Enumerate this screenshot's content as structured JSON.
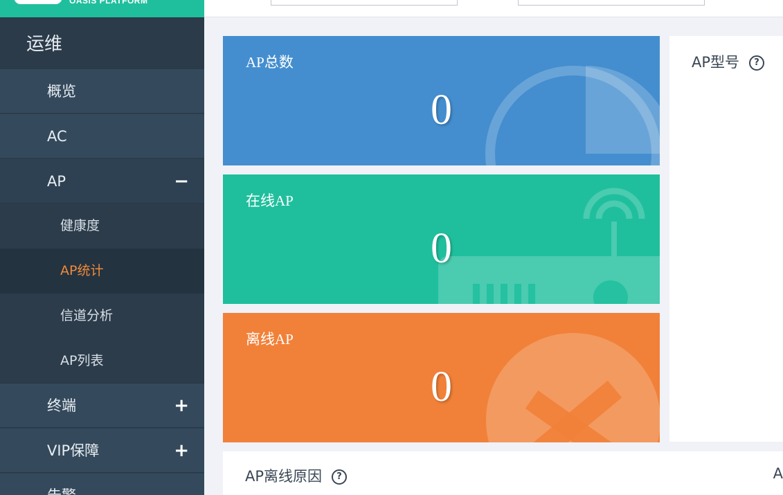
{
  "logo": {
    "subtitle": "OASIS PLATFORM"
  },
  "sidebar": {
    "section": "运维",
    "items": [
      {
        "label": "概览"
      },
      {
        "label": "AC"
      },
      {
        "label": "AP",
        "toggle": "−"
      },
      {
        "label": "健康度"
      },
      {
        "label": "AP统计",
        "active": true
      },
      {
        "label": "信道分析"
      },
      {
        "label": "AP列表"
      },
      {
        "label": "终端",
        "toggle": "+"
      },
      {
        "label": "VIP保障",
        "toggle": "+"
      },
      {
        "label": "告警"
      }
    ]
  },
  "cards": [
    {
      "title": "AP总数",
      "value": "0",
      "color": "#448ecf",
      "icon": "pie-chart-icon"
    },
    {
      "title": "在线AP",
      "value": "0",
      "color": "#1fbf9d",
      "icon": "router-icon"
    },
    {
      "title": "离线AP",
      "value": "0",
      "color": "#f18139",
      "icon": "offline-x-icon"
    }
  ],
  "panels": {
    "ap_model": {
      "title": "AP型号",
      "help": "?"
    },
    "ap_offline_reason": {
      "title": "AP离线原因",
      "help": "?",
      "edge": "A"
    }
  },
  "colors": {
    "accent": "#f08a3a",
    "sidebar": "#2e3f4f"
  }
}
